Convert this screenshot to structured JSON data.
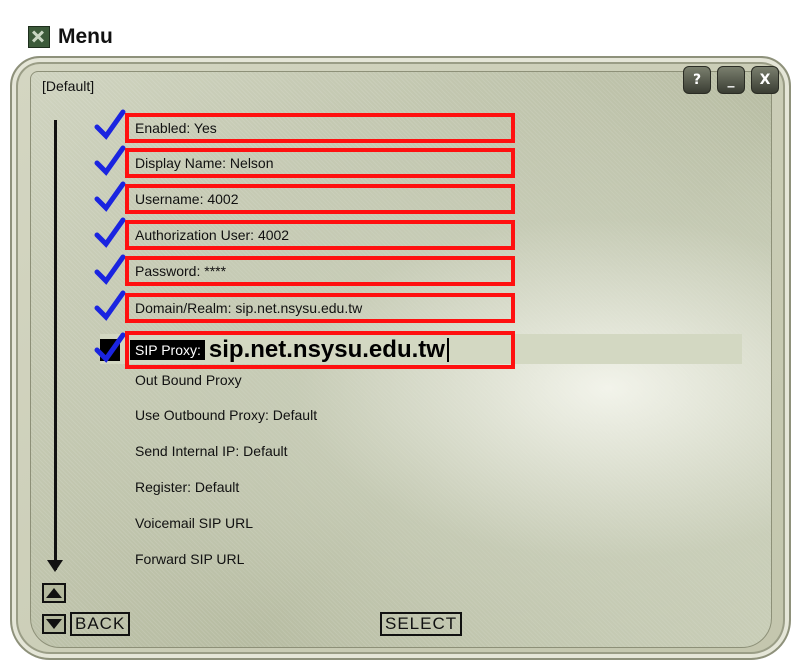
{
  "window": {
    "title": "Menu",
    "breadcrumb": "[Default]",
    "buttons": {
      "help": "?",
      "minimize": "_",
      "close": "X"
    }
  },
  "menu": {
    "items": [
      {
        "label": "Enabled: Yes",
        "checked": true,
        "highlighted": true
      },
      {
        "label": "Display Name: Nelson",
        "checked": true,
        "highlighted": true
      },
      {
        "label": "Username: 4002",
        "checked": true,
        "highlighted": true
      },
      {
        "label": "Authorization User: 4002",
        "checked": true,
        "highlighted": true
      },
      {
        "label": "Password: ****",
        "checked": true,
        "highlighted": true
      },
      {
        "label": "Domain/Realm: sip.net.nsysu.edu.tw",
        "checked": true,
        "highlighted": true
      },
      {
        "label": "SIP Proxy:",
        "value": "sip.net.nsysu.edu.tw",
        "checked": true,
        "highlighted": true,
        "active": true
      },
      {
        "label": "Out Bound Proxy"
      },
      {
        "label": "Use Outbound Proxy: Default"
      },
      {
        "label": "Send Internal IP: Default"
      },
      {
        "label": "Register: Default"
      },
      {
        "label": "Voicemail SIP URL"
      },
      {
        "label": "Forward SIP URL"
      }
    ]
  },
  "footer": {
    "back_label": "BACK",
    "select_label": "SELECT"
  },
  "colors": {
    "check": "#1a24e0",
    "highlight": "#ff1010"
  }
}
